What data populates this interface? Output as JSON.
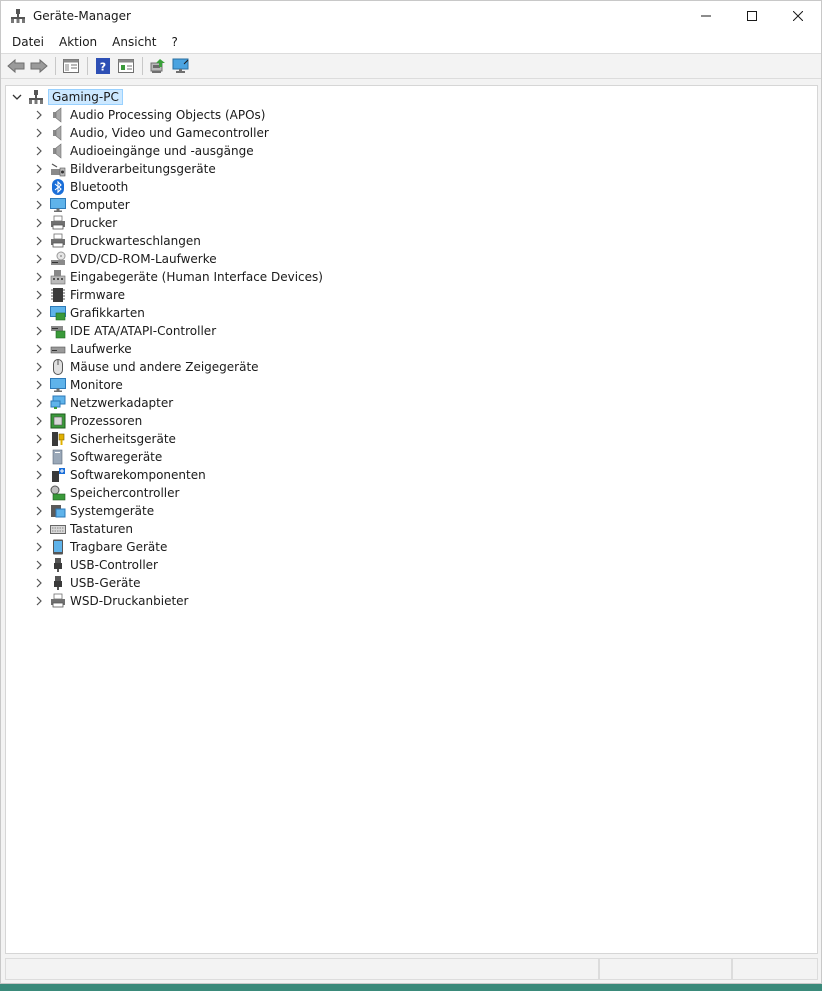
{
  "window": {
    "title": "Geräte-Manager"
  },
  "menu": [
    "Datei",
    "Aktion",
    "Ansicht",
    "?"
  ],
  "toolbar": {
    "buttons": [
      {
        "name": "back-button",
        "icon": "arrow-left-icon"
      },
      {
        "name": "forward-button",
        "icon": "arrow-right-icon"
      },
      {
        "name": "show-hide-console-tree-button",
        "icon": "console-tree-icon"
      },
      {
        "name": "help-button",
        "icon": "help-icon"
      },
      {
        "name": "properties-button",
        "icon": "properties-icon"
      },
      {
        "name": "update-driver-button",
        "icon": "update-driver-icon"
      },
      {
        "name": "scan-hardware-button",
        "icon": "monitor-scan-icon"
      }
    ]
  },
  "tree": {
    "root": {
      "label": "Gaming-PC",
      "expanded": true,
      "icon": "computer-tree-icon"
    },
    "children": [
      {
        "label": "Audio Processing Objects (APOs)",
        "icon": "speaker-icon"
      },
      {
        "label": "Audio, Video und Gamecontroller",
        "icon": "speaker-icon"
      },
      {
        "label": "Audioeingänge und -ausgänge",
        "icon": "speaker-icon"
      },
      {
        "label": "Bildverarbeitungsgeräte",
        "icon": "camera-icon"
      },
      {
        "label": "Bluetooth",
        "icon": "bluetooth-icon"
      },
      {
        "label": "Computer",
        "icon": "monitor-icon"
      },
      {
        "label": "Drucker",
        "icon": "printer-icon"
      },
      {
        "label": "Druckwarteschlangen",
        "icon": "printer-icon"
      },
      {
        "label": "DVD/CD-ROM-Laufwerke",
        "icon": "disc-drive-icon"
      },
      {
        "label": "Eingabegeräte (Human Interface Devices)",
        "icon": "hid-icon"
      },
      {
        "label": "Firmware",
        "icon": "chip-icon"
      },
      {
        "label": "Grafikkarten",
        "icon": "graphics-card-icon"
      },
      {
        "label": "IDE ATA/ATAPI-Controller",
        "icon": "controller-icon"
      },
      {
        "label": "Laufwerke",
        "icon": "drive-icon"
      },
      {
        "label": "Mäuse und andere Zeigegeräte",
        "icon": "mouse-icon"
      },
      {
        "label": "Monitore",
        "icon": "monitor-icon"
      },
      {
        "label": "Netzwerkadapter",
        "icon": "network-icon"
      },
      {
        "label": "Prozessoren",
        "icon": "processor-icon"
      },
      {
        "label": "Sicherheitsgeräte",
        "icon": "security-icon"
      },
      {
        "label": "Softwaregeräte",
        "icon": "software-device-icon"
      },
      {
        "label": "Softwarekomponenten",
        "icon": "software-component-icon"
      },
      {
        "label": "Speichercontroller",
        "icon": "storage-controller-icon"
      },
      {
        "label": "Systemgeräte",
        "icon": "system-device-icon"
      },
      {
        "label": "Tastaturen",
        "icon": "keyboard-icon"
      },
      {
        "label": "Tragbare Geräte",
        "icon": "portable-device-icon"
      },
      {
        "label": "USB-Controller",
        "icon": "usb-icon"
      },
      {
        "label": "USB-Geräte",
        "icon": "usb-icon"
      },
      {
        "label": "WSD-Druckanbieter",
        "icon": "printer-icon"
      }
    ]
  },
  "colors": {
    "selection": "#cce8ff",
    "selection_border": "#99d1ff",
    "accent": "#0078d4"
  }
}
